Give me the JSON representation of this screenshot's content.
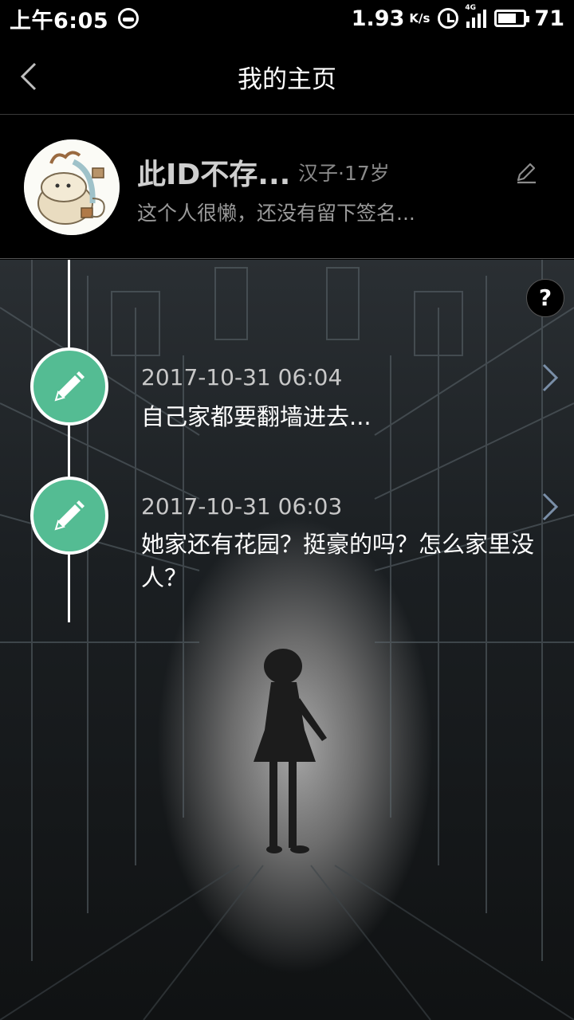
{
  "status_bar": {
    "time": "上午6:05",
    "net_speed": "1.93",
    "net_unit": "K/s",
    "network_label": "4G",
    "battery": "71",
    "battery_level_percent": 71
  },
  "nav": {
    "title": "我的主页",
    "back_icon": "chevron-left-icon"
  },
  "profile": {
    "name": "此ID不存...",
    "meta": "汉子·17岁",
    "signature": "这个人很懒，还没有留下签名...",
    "edit_icon": "pencil-icon"
  },
  "help_label": "?",
  "timeline": [
    {
      "date": "2017-10-31 06:04",
      "text": "自己家都要翻墙进去..."
    },
    {
      "date": "2017-10-31 06:03",
      "text": "她家还有花园？挺豪的吗？怎么家里没人？"
    }
  ],
  "colors": {
    "accent_green": "#54bc93",
    "background": "#000000",
    "chevron": "#7a8fa8"
  }
}
